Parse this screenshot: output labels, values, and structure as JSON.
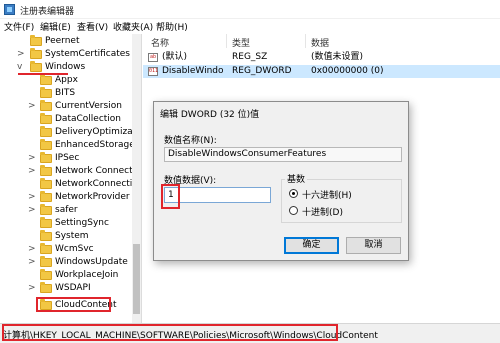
{
  "window": {
    "title": "注册表编辑器"
  },
  "menu": [
    "文件(F)",
    "编辑(E)",
    "查看(V)",
    "收藏夹(A)",
    "帮助(H)"
  ],
  "tree": {
    "items": [
      {
        "label": "Peernet",
        "arrow": ""
      },
      {
        "label": "SystemCertificates",
        "arrow": ">"
      },
      {
        "label": "Windows",
        "arrow": "v"
      },
      {
        "label": "Appx",
        "arrow": ""
      },
      {
        "label": "BITS",
        "arrow": ""
      },
      {
        "label": "CurrentVersion",
        "arrow": ">"
      },
      {
        "label": "DataCollection",
        "arrow": ""
      },
      {
        "label": "DeliveryOptimization",
        "arrow": ""
      },
      {
        "label": "EnhancedStorageDe",
        "arrow": ""
      },
      {
        "label": "IPSec",
        "arrow": ">"
      },
      {
        "label": "Network Connection",
        "arrow": ">"
      },
      {
        "label": "NetworkConnectivity",
        "arrow": ""
      },
      {
        "label": "NetworkProvider",
        "arrow": ">"
      },
      {
        "label": "safer",
        "arrow": ">"
      },
      {
        "label": "SettingSync",
        "arrow": ""
      },
      {
        "label": "System",
        "arrow": ""
      },
      {
        "label": "WcmSvc",
        "arrow": ">"
      },
      {
        "label": "WindowsUpdate",
        "arrow": ">"
      },
      {
        "label": "WorkplaceJoin",
        "arrow": ""
      },
      {
        "label": "WSDAPI",
        "arrow": ">"
      },
      {
        "label": "CloudContent",
        "arrow": ""
      }
    ]
  },
  "list": {
    "headers": {
      "name": "名称",
      "type": "类型",
      "data": "数据"
    },
    "rows": [
      {
        "icon": "ab",
        "name": "(默认)",
        "type": "REG_SZ",
        "data": "(数值未设置)"
      },
      {
        "icon": "011",
        "name": "DisableWindo...",
        "type": "REG_DWORD",
        "data": "0x00000000 (0)"
      }
    ]
  },
  "status": {
    "path": "计算机\\HKEY_LOCAL_MACHINE\\SOFTWARE\\Policies\\Microsoft\\Windows\\CloudContent"
  },
  "dialog": {
    "title": "编辑 DWORD (32 位)值",
    "name_label": "数值名称(N):",
    "name_value": "DisableWindowsConsumerFeatures",
    "data_label": "数值数据(V):",
    "data_value": "1",
    "base_label": "基数",
    "radio_hex": "十六进制(H)",
    "radio_dec": "十进制(D)",
    "ok": "确定",
    "cancel": "取消"
  },
  "colors": {
    "highlight": "#e0252c",
    "selection": "#cce8ff",
    "accent": "#0078d7"
  }
}
